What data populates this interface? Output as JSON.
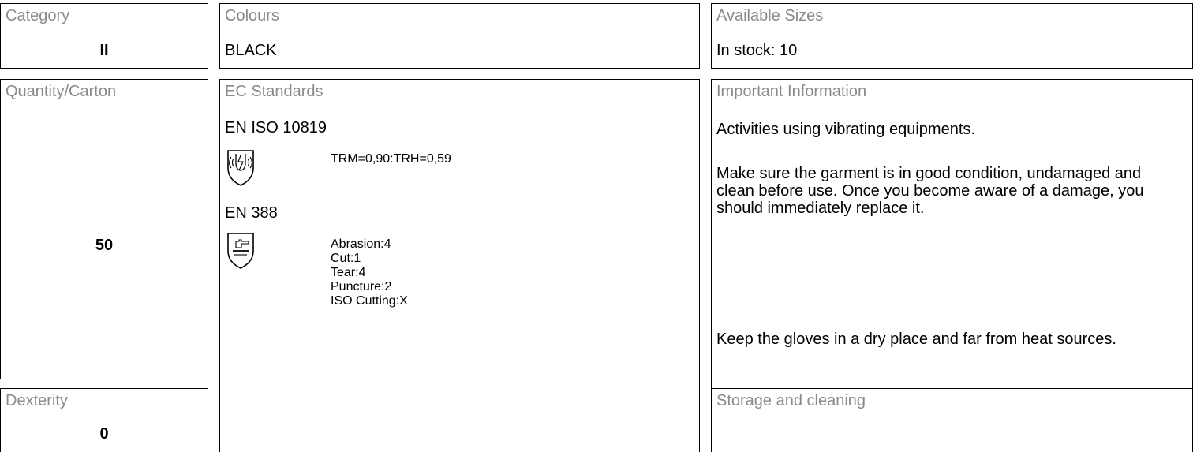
{
  "category": {
    "label": "Category",
    "value": "II"
  },
  "colours": {
    "label": "Colours",
    "value": "BLACK"
  },
  "sizes": {
    "label": "Available Sizes",
    "value": "In stock: 10"
  },
  "quantity": {
    "label": "Quantity/Carton",
    "value": "50"
  },
  "dexterity": {
    "label": "Dexterity",
    "value": "0"
  },
  "standards": {
    "label": "EC Standards",
    "items": [
      {
        "name": "EN ISO 10819",
        "icon": "vibration-pictogram-icon",
        "values": [
          "TRM=0,90:TRH=0,59"
        ]
      },
      {
        "name": "EN 388",
        "icon": "mechanical-risk-pictogram-icon",
        "values": [
          "Abrasion:4",
          "Cut:1",
          "Tear:4",
          "Puncture:2",
          "ISO Cutting:X"
        ]
      }
    ]
  },
  "important": {
    "label": "Important Information",
    "paragraphs": [
      "Activities using vibrating equipments.",
      "Make sure the garment is in good condition, undamaged and clean before use. Once you become aware of a damage, you should immediately replace it.",
      "Keep the gloves in a dry place and far from heat sources."
    ]
  },
  "storage": {
    "label": "Storage and cleaning"
  }
}
